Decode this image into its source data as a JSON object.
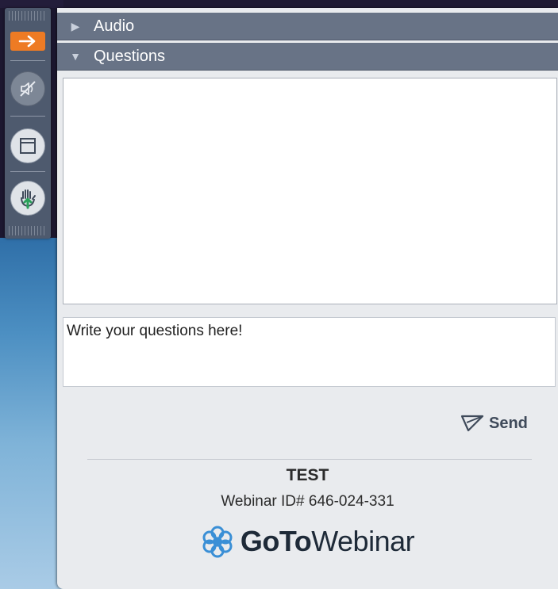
{
  "toolbar": {
    "icons": [
      "arrow-right-icon",
      "muted-speaker-icon",
      "window-icon",
      "raise-hand-icon"
    ]
  },
  "sections": {
    "audio": {
      "label": "Audio",
      "expanded": false
    },
    "questions": {
      "label": "Questions",
      "expanded": true
    }
  },
  "questions": {
    "input_placeholder": "Write your questions here!",
    "send_label": "Send"
  },
  "webinar": {
    "title": "TEST",
    "id_text": "Webinar ID# 646-024-331"
  },
  "brand": {
    "name_bold": "GoTo",
    "name_light": "Webinar"
  },
  "colors": {
    "accent_orange": "#ee7b24",
    "header_bg": "#687386",
    "brand_blue": "#3a8fd6"
  }
}
